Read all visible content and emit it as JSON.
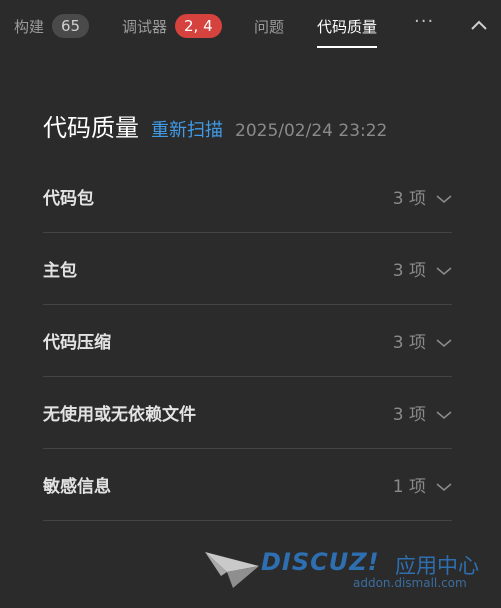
{
  "tabs": [
    {
      "label": "构建",
      "badge": "65",
      "badge_style": "gray"
    },
    {
      "label": "调试器",
      "badge": "2, 4",
      "badge_style": "red"
    },
    {
      "label": "问题"
    },
    {
      "label": "代码质量",
      "active": true
    }
  ],
  "toolbar": {
    "more_label": "···",
    "collapse_icon": "chevron-up-icon"
  },
  "header": {
    "title": "代码质量",
    "rescan_label": "重新扫描",
    "timestamp": "2025/02/24 23:22"
  },
  "items": [
    {
      "name": "代码包",
      "count": "3 项"
    },
    {
      "name": "主包",
      "count": "3 项"
    },
    {
      "name": "代码压缩",
      "count": "3 项"
    },
    {
      "name": "无使用或无依赖文件",
      "count": "3 项"
    },
    {
      "name": "敏感信息",
      "count": "1 项"
    }
  ],
  "watermark": {
    "brand": "DISCUZ!",
    "subtitle": "应用中心",
    "url": "addon.dismall.com"
  },
  "colors": {
    "accent": "#3f9be8",
    "badge_red": "#d6433f",
    "background": "#2b2b2b"
  }
}
